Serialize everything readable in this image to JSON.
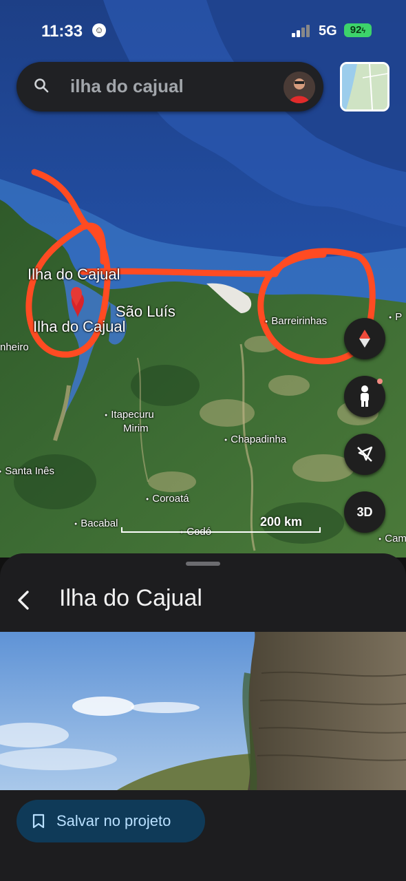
{
  "status_bar": {
    "time": "11:33",
    "network": "5G",
    "battery": "92"
  },
  "search": {
    "query": "ilha do cajual"
  },
  "map": {
    "places": {
      "ilha_do_cajual_top": "Ilha do Cajual",
      "ilha_do_cajual_bottom": "Ilha do Cajual",
      "sao_luis": "São Luís",
      "pinheiro": "nheiro",
      "barreirinhas": "Barreirinhas",
      "itapecuru": "Itapecuru",
      "mirim": "Mirim",
      "chapadinha": "Chapadinha",
      "santa_ines": "Santa Inês",
      "coroata": "Coroatá",
      "bacabal": "Bacabal",
      "codo": "Codó",
      "edge_right_top": "P",
      "edge_right_bottom": "Cam"
    },
    "scale": "200 km",
    "buttons": {
      "three_d": "3D"
    }
  },
  "sheet": {
    "title": "Ilha do Cajual",
    "save_label": "Salvar no projeto"
  },
  "colors": {
    "annotation": "#ff4b22",
    "save_button": "#0f3a58",
    "battery": "#3dd36b"
  }
}
